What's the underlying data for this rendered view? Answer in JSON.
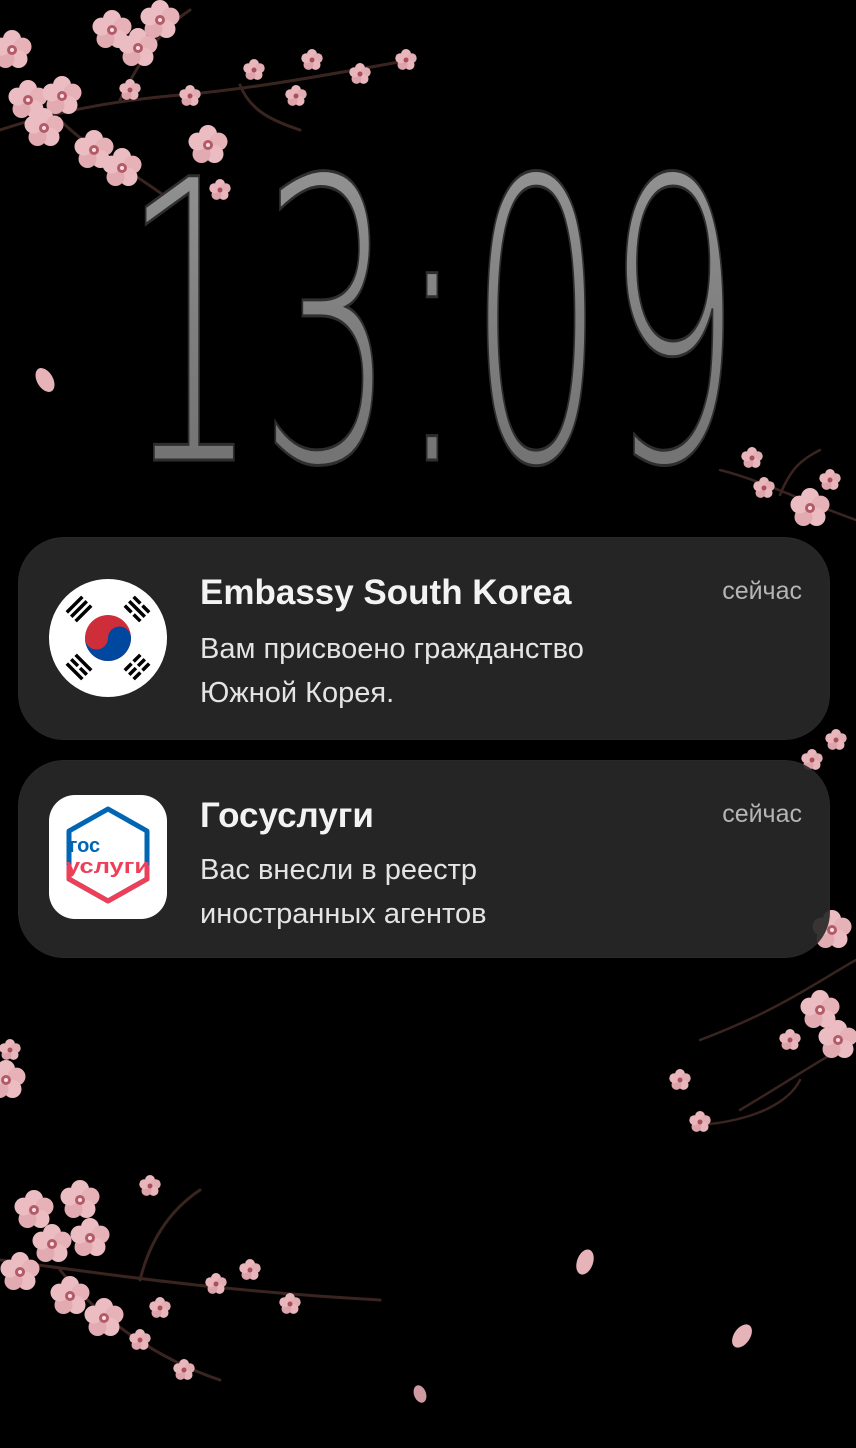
{
  "lockscreen": {
    "clock": "13:09"
  },
  "notifications": [
    {
      "app": "Embassy South Korea",
      "icon": "korea-flag-icon",
      "time": "сейчас",
      "body_lines": [
        "Вам присвоено гражданство",
        "Южной Корея."
      ]
    },
    {
      "app": "Госуслуги",
      "icon": "gosuslugi-icon",
      "icon_text": [
        "гос",
        "услуги"
      ],
      "time": "сейчас",
      "body_lines": [
        "Вас внесли в реестр",
        "иностранных агентов"
      ]
    }
  ],
  "colors": {
    "background": "#000000",
    "card": "#282828",
    "blossom": "#e8b8bd",
    "korea_red": "#cd2e3a",
    "korea_blue": "#0047a0",
    "gosuslugi_red": "#ee3f58",
    "gosuslugi_blue": "#0066b3"
  }
}
